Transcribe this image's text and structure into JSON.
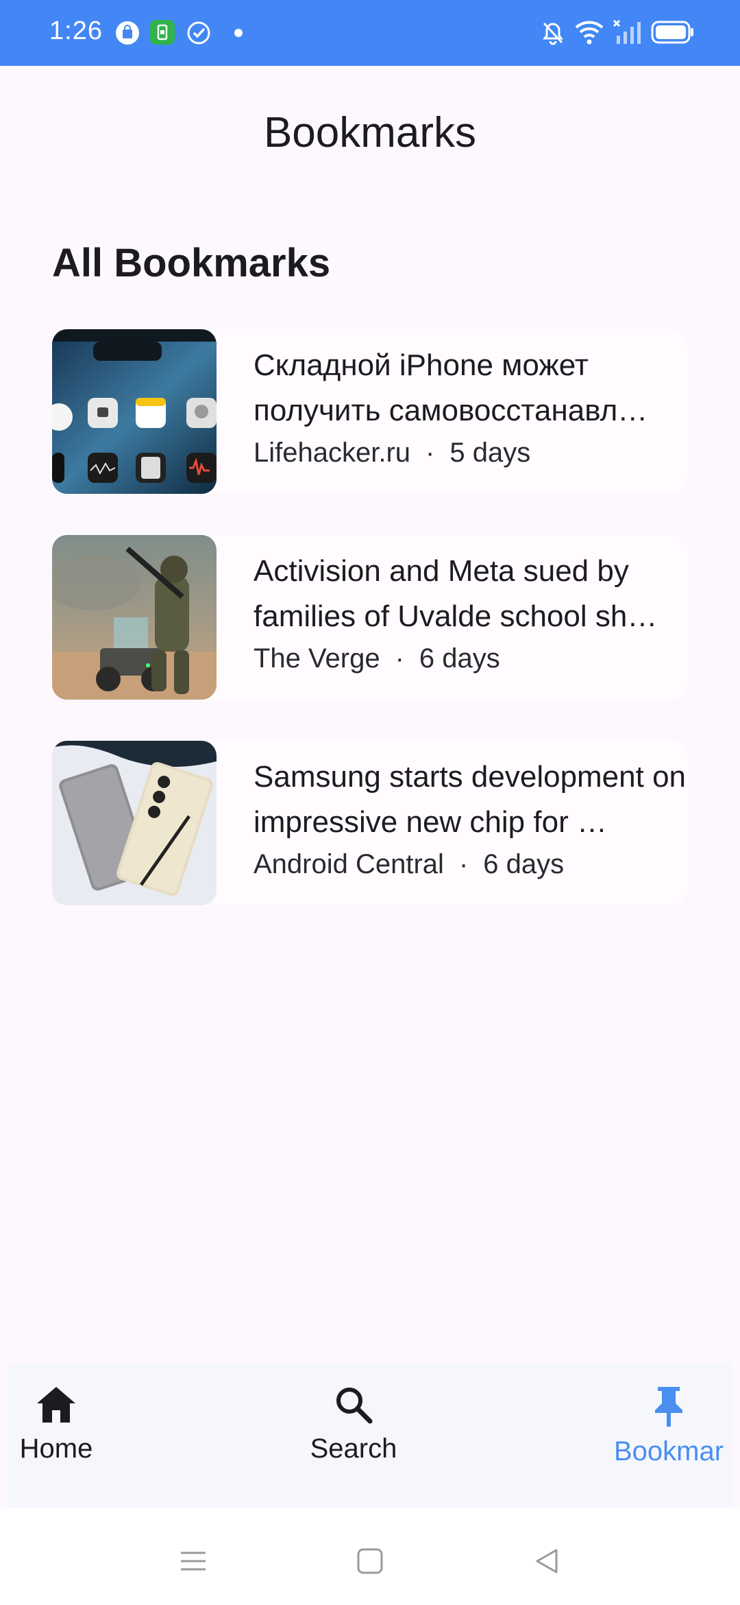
{
  "status_bar": {
    "time": "1:26",
    "left_icons": [
      "shopping-bag-icon",
      "sim-app-icon",
      "check-circle-icon",
      "dot-icon"
    ],
    "right_icons": [
      "bell-off-icon",
      "wifi-icon",
      "signal-off-icon",
      "battery-icon"
    ],
    "color": "#4287f5"
  },
  "page": {
    "title": "Bookmarks",
    "section_title": "All Bookmarks"
  },
  "bookmarks": [
    {
      "title": "Складной iPhone может получить самовосстанавл…",
      "source": "Lifehacker.ru",
      "separator": "·",
      "age": "5 days",
      "thumbnail": "iphone-homescreen-image"
    },
    {
      "title": "Activision and Meta sued by families of Uvalde school sh…",
      "source": "The Verge",
      "separator": "·",
      "age": "6 days",
      "thumbnail": "soldier-game-image"
    },
    {
      "title": "Samsung starts development on impressive new chip for …",
      "source": "Android Central",
      "separator": "·",
      "age": "6 days",
      "thumbnail": "samsung-phones-image"
    }
  ],
  "bottom_nav": {
    "items": [
      {
        "label": "Home",
        "icon": "home-icon"
      },
      {
        "label": "Search",
        "icon": "search-icon"
      },
      {
        "label": "Bookmar",
        "icon": "pin-icon",
        "active": true
      }
    ],
    "active_color": "#4a8ef0"
  },
  "system_nav": [
    "menu-icon",
    "home-square-icon",
    "back-triangle-icon"
  ]
}
